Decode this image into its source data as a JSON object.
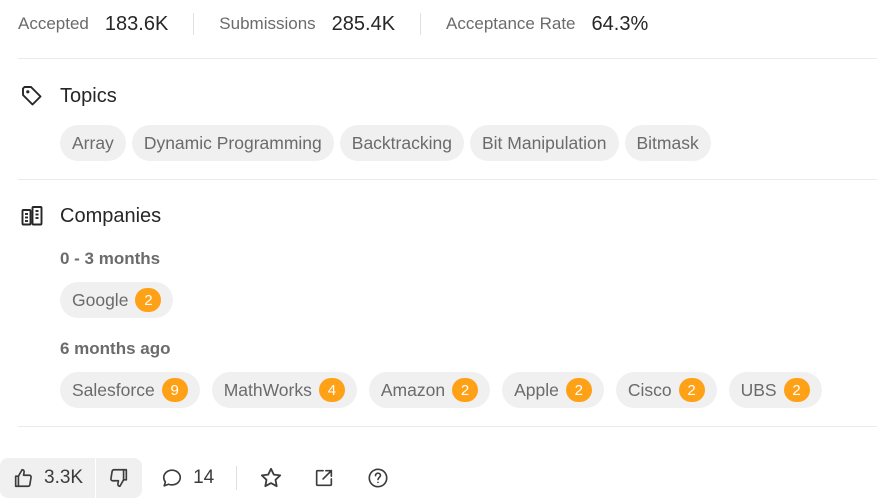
{
  "stats": [
    {
      "label": "Accepted",
      "value": "183.6K"
    },
    {
      "label": "Submissions",
      "value": "285.4K"
    },
    {
      "label": "Acceptance Rate",
      "value": "64.3%"
    }
  ],
  "topics": {
    "title": "Topics",
    "icon": "tag-icon",
    "tags": [
      "Array",
      "Dynamic Programming",
      "Backtracking",
      "Bit Manipulation",
      "Bitmask"
    ]
  },
  "companies": {
    "title": "Companies",
    "icon": "building-icon",
    "accent_color": "#ffa116",
    "periods": [
      {
        "label": "0 - 3 months",
        "items": [
          {
            "name": "Google",
            "count": "2"
          }
        ]
      },
      {
        "label": "6 months ago",
        "items": [
          {
            "name": "Salesforce",
            "count": "9"
          },
          {
            "name": "MathWorks",
            "count": "4"
          },
          {
            "name": "Amazon",
            "count": "2"
          },
          {
            "name": "Apple",
            "count": "2"
          },
          {
            "name": "Cisco",
            "count": "2"
          },
          {
            "name": "UBS",
            "count": "2"
          }
        ]
      }
    ]
  },
  "actions": {
    "likes": "3.3K",
    "comments": "14",
    "icons": [
      "thumbs-up-icon",
      "thumbs-down-icon",
      "comment-icon",
      "star-icon",
      "share-icon",
      "help-icon"
    ]
  }
}
